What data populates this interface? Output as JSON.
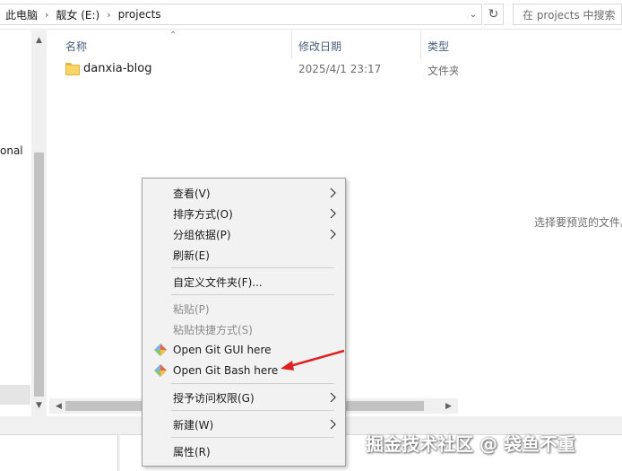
{
  "address_bar": {
    "crumbs": [
      "此电脑",
      "靓女 (E:)",
      "projects"
    ],
    "separator": "›",
    "search_placeholder": "在 projects 中搜索"
  },
  "nav_pane": {
    "partial_item_text": "onal"
  },
  "file_list": {
    "columns": [
      "名称",
      "修改日期",
      "类型"
    ],
    "rows": [
      {
        "name": "danxia-blog",
        "modified": "2025/4/1 23:17",
        "type": "文件夹",
        "icon": "folder-icon"
      }
    ]
  },
  "preview_pane": {
    "message": "选择要预览的文件。"
  },
  "context_menu": {
    "items": [
      {
        "label": "查看(V)",
        "submenu": true,
        "enabled": true
      },
      {
        "label": "排序方式(O)",
        "submenu": true,
        "enabled": true
      },
      {
        "label": "分组依据(P)",
        "submenu": true,
        "enabled": true
      },
      {
        "label": "刷新(E)",
        "submenu": false,
        "enabled": true
      },
      {
        "label": "自定义文件夹(F)...",
        "submenu": false,
        "enabled": true
      },
      {
        "label": "粘贴(P)",
        "submenu": false,
        "enabled": false
      },
      {
        "label": "粘贴快捷方式(S)",
        "submenu": false,
        "enabled": false
      },
      {
        "label": "Open Git GUI here",
        "submenu": false,
        "enabled": true,
        "icon": "git-gui-icon"
      },
      {
        "label": "Open Git Bash here",
        "submenu": false,
        "enabled": true,
        "icon": "git-bash-icon"
      },
      {
        "label": "授予访问权限(G)",
        "submenu": true,
        "enabled": true
      },
      {
        "label": "新建(W)",
        "submenu": true,
        "enabled": true
      },
      {
        "label": "属性(R)",
        "submenu": false,
        "enabled": true
      }
    ]
  },
  "annotation": {
    "arrow_color": "#e02020"
  },
  "watermark": "掘金技术社区 @ 袋鱼不重"
}
